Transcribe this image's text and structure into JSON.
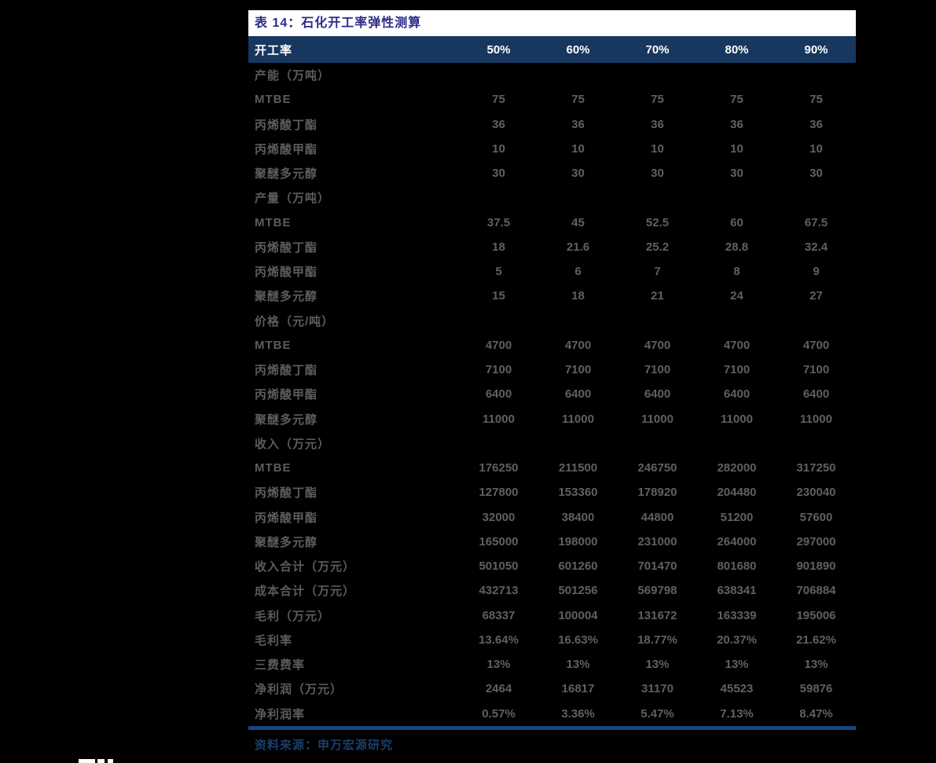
{
  "table": {
    "title": "表 14：石化开工率弹性测算",
    "header": {
      "label": "开工率",
      "columns": [
        "50%",
        "60%",
        "70%",
        "80%",
        "90%"
      ]
    },
    "rows": [
      {
        "type": "section",
        "label": "产能（万吨）",
        "values": [
          "",
          "",
          "",
          "",
          ""
        ]
      },
      {
        "type": "data",
        "label": "MTBE",
        "values": [
          "75",
          "75",
          "75",
          "75",
          "75"
        ]
      },
      {
        "type": "data",
        "label": "丙烯酸丁酯",
        "values": [
          "36",
          "36",
          "36",
          "36",
          "36"
        ]
      },
      {
        "type": "data",
        "label": "丙烯酸甲酯",
        "values": [
          "10",
          "10",
          "10",
          "10",
          "10"
        ]
      },
      {
        "type": "data",
        "label": "聚醚多元醇",
        "values": [
          "30",
          "30",
          "30",
          "30",
          "30"
        ]
      },
      {
        "type": "section",
        "label": "产量（万吨）",
        "values": [
          "",
          "",
          "",
          "",
          ""
        ]
      },
      {
        "type": "data",
        "label": "MTBE",
        "values": [
          "37.5",
          "45",
          "52.5",
          "60",
          "67.5"
        ]
      },
      {
        "type": "data",
        "label": "丙烯酸丁酯",
        "values": [
          "18",
          "21.6",
          "25.2",
          "28.8",
          "32.4"
        ]
      },
      {
        "type": "data",
        "label": "丙烯酸甲酯",
        "values": [
          "5",
          "6",
          "7",
          "8",
          "9"
        ]
      },
      {
        "type": "data",
        "label": "聚醚多元醇",
        "values": [
          "15",
          "18",
          "21",
          "24",
          "27"
        ]
      },
      {
        "type": "section",
        "label": "价格（元/吨）",
        "values": [
          "",
          "",
          "",
          "",
          ""
        ]
      },
      {
        "type": "data",
        "label": "MTBE",
        "values": [
          "4700",
          "4700",
          "4700",
          "4700",
          "4700"
        ]
      },
      {
        "type": "data",
        "label": "丙烯酸丁酯",
        "values": [
          "7100",
          "7100",
          "7100",
          "7100",
          "7100"
        ]
      },
      {
        "type": "data",
        "label": "丙烯酸甲酯",
        "values": [
          "6400",
          "6400",
          "6400",
          "6400",
          "6400"
        ]
      },
      {
        "type": "data",
        "label": "聚醚多元醇",
        "values": [
          "11000",
          "11000",
          "11000",
          "11000",
          "11000"
        ]
      },
      {
        "type": "section",
        "label": "收入（万元）",
        "values": [
          "",
          "",
          "",
          "",
          ""
        ]
      },
      {
        "type": "data",
        "label": "MTBE",
        "values": [
          "176250",
          "211500",
          "246750",
          "282000",
          "317250"
        ]
      },
      {
        "type": "data",
        "label": "丙烯酸丁酯",
        "values": [
          "127800",
          "153360",
          "178920",
          "204480",
          "230040"
        ]
      },
      {
        "type": "data",
        "label": "丙烯酸甲酯",
        "values": [
          "32000",
          "38400",
          "44800",
          "51200",
          "57600"
        ]
      },
      {
        "type": "data",
        "label": "聚醚多元醇",
        "values": [
          "165000",
          "198000",
          "231000",
          "264000",
          "297000"
        ]
      },
      {
        "type": "data",
        "label": "收入合计（万元）",
        "values": [
          "501050",
          "601260",
          "701470",
          "801680",
          "901890"
        ]
      },
      {
        "type": "data",
        "label": "成本合计（万元）",
        "values": [
          "432713",
          "501256",
          "569798",
          "638341",
          "706884"
        ]
      },
      {
        "type": "data",
        "label": "毛利（万元）",
        "values": [
          "68337",
          "100004",
          "131672",
          "163339",
          "195006"
        ]
      },
      {
        "type": "data",
        "label": "毛利率",
        "values": [
          "13.64%",
          "16.63%",
          "18.77%",
          "20.37%",
          "21.62%"
        ]
      },
      {
        "type": "data",
        "label": "三费费率",
        "values": [
          "13%",
          "13%",
          "13%",
          "13%",
          "13%"
        ]
      },
      {
        "type": "data",
        "label": "净利润（万元）",
        "values": [
          "2464",
          "16817",
          "31170",
          "45523",
          "59876"
        ]
      },
      {
        "type": "data",
        "label": "净利润率",
        "values": [
          "0.57%",
          "3.36%",
          "5.47%",
          "7.13%",
          "8.47%"
        ]
      }
    ],
    "source": "资料来源：申万宏源研究"
  },
  "colors": {
    "page_bg": "#000000",
    "title_bg": "#ffffff",
    "title_text": "#2b2b8c",
    "header_bg": "#17375e",
    "header_text": "#ffffff",
    "body_text": "#5c5c5c",
    "divider": "#14477e",
    "source_text": "#1b3e6f"
  }
}
